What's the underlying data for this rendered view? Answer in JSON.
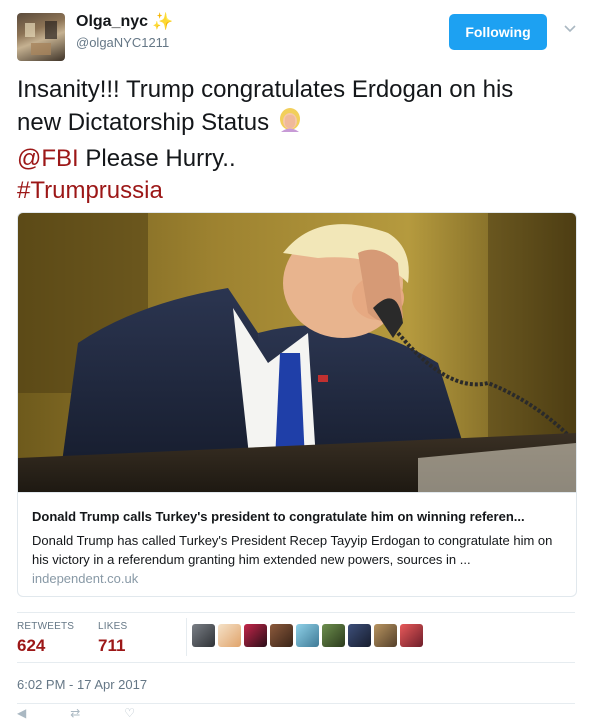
{
  "author": {
    "display_name": "Olga_nyc",
    "badge_icon": "sparkles-icon",
    "handle": "@olgaNYC1211"
  },
  "follow_button": {
    "label": "Following",
    "color": "#1da1f2"
  },
  "tweet": {
    "line1": "Insanity!!! Trump congratulates Erdogan on his",
    "line2": "new Dictatorship Status",
    "emoji": "woman-facepalming-emoji",
    "mention": "@FBI",
    "line3_rest": " Please Hurry..",
    "hashtag": "#Trumprussia",
    "link_color": "#9c1717"
  },
  "card": {
    "title": "Donald Trump calls Turkey's president to congratulate him on winning referen...",
    "description": "Donald Trump has called Turkey's President Recep Tayyip Erdogan to congratulate him on his victory in a referendum granting him extended new powers, sources in ...",
    "domain": "independent.co.uk"
  },
  "stats": {
    "retweets_label": "RETWEETS",
    "retweets_value": "624",
    "likes_label": "LIKES",
    "likes_value": "711"
  },
  "timestamp": "6:02 PM - 17 Apr 2017"
}
